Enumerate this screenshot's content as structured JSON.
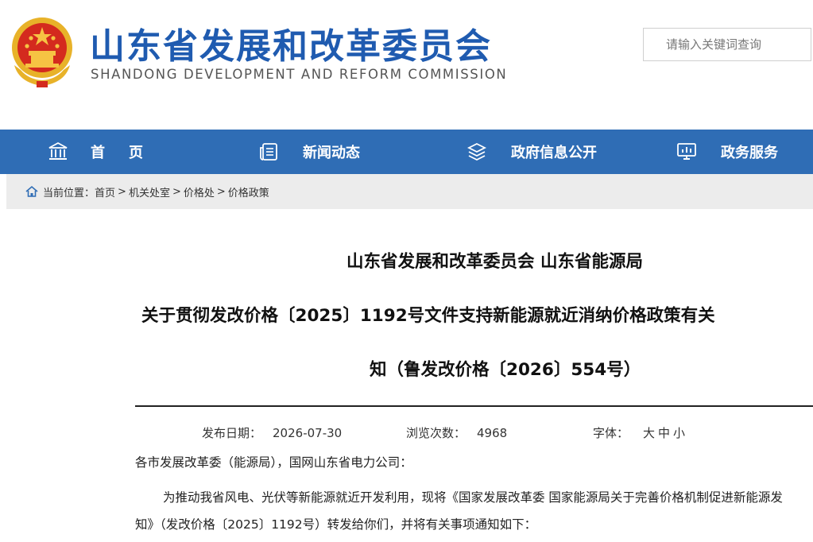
{
  "header": {
    "site_title": "山东省发展和改革委员会",
    "site_subtitle": "SHANDONG DEVELOPMENT AND REFORM COMMISSION",
    "search_placeholder": "请输入关键词查询"
  },
  "nav": {
    "items": [
      {
        "label": "首页",
        "icon": "building-icon"
      },
      {
        "label": "新闻动态",
        "icon": "news-icon"
      },
      {
        "label": "政府信息公开",
        "icon": "layers-icon"
      },
      {
        "label": "政务服务",
        "icon": "monitor-icon"
      }
    ]
  },
  "breadcrumb": {
    "prefix": "当前位置：",
    "items": [
      "首页",
      "机关处室",
      "价格处",
      "价格政策"
    ],
    "separator": ">"
  },
  "article": {
    "heading_line1": "山东省发展和改革委员会 山东省能源局",
    "heading_line2": "关于贯彻发改价格〔2025〕1192号文件支持新能源就近消纳价格政策有关",
    "heading_line3": "知（鲁发改价格〔2026〕554号）",
    "publish_label": "发布日期：",
    "publish_date": "2026-07-30",
    "views_label": "浏览次数：",
    "views_count": "4968",
    "font_label": "字体：",
    "font_options": [
      "大",
      "中",
      "小"
    ],
    "para0": "各市发展改革委（能源局），国网山东省电力公司：",
    "para1": "为推动我省风电、光伏等新能源就近开发利用，现将《国家发展改革委 国家能源局关于完善价格机制促进新能源发",
    "para2": "知》（发改价格〔2025〕1192号）转发给你们，并将有关事项通知如下："
  },
  "colors": {
    "brand_blue": "#1f5bb0",
    "nav_blue": "#2f6db5",
    "breadcrumb_bg": "#ececec"
  }
}
